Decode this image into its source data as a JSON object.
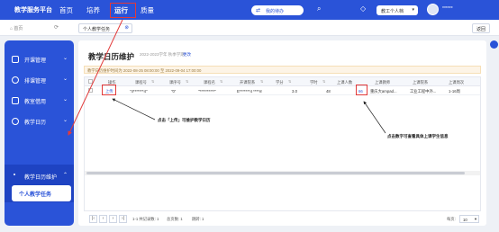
{
  "topbar": {
    "brand": "教学服务平台",
    "nav": [
      "首页",
      "培养",
      "运行",
      "质量"
    ],
    "active_nav": "运行",
    "pill_label": "我的待办",
    "select_label": "教工个人档",
    "user_name": "******"
  },
  "crumbbar": {
    "home_label": "首页",
    "tab_label": "个人教学任务",
    "return_label": "返回"
  },
  "sidebar": {
    "items": [
      {
        "label": "开课管理",
        "icon": "course-icon"
      },
      {
        "label": "排课管理",
        "icon": "schedule-icon"
      },
      {
        "label": "教室借用",
        "icon": "room-icon"
      },
      {
        "label": "教学日历",
        "icon": "calendar-icon"
      },
      {
        "label": "教学日历维护",
        "icon": "calendar-edit-icon"
      }
    ],
    "sub_item": "个人教学任务"
  },
  "main": {
    "title": "教学日历维护",
    "subtitle": "2022-2023学年 秋季学期",
    "switch_label": "更改",
    "notice": "教学日历维护时间为 2022-08-25 08:00:00 至 2022-09-04 17:00:00",
    "columns": [
      "操作",
      "课程号",
      "课序号",
      "课程名",
      "开课院系",
      "学分",
      "学时",
      "上课人数",
      "上课教师",
      "上课院系",
      "上课周次"
    ],
    "rows": [
      {
        "action": "上传",
        "course_no": "\"4*******4\"",
        "section": "\"0\"",
        "course_name": "\"**********\"",
        "dept": "E*******4 ****m",
        "credit": "3.0",
        "hours": "48",
        "students": "66",
        "teacher": "重庆大ampad...",
        "teach_dept": "工业工程中外...",
        "weeks": "1-16周"
      }
    ]
  },
  "pager": {
    "info": "1-1 共记录数: 1",
    "pages": "总页数: 1",
    "jump": "跳转: 1",
    "per_page_label": "每页:",
    "per_page": "10"
  },
  "annotations": {
    "upload_hint": "点击「上传」可维护教学日历",
    "count_hint": "点击数字可查看具体上课学生信息"
  },
  "colors": {
    "brand": "#2a53d8",
    "highlight": "#e23a3a"
  }
}
